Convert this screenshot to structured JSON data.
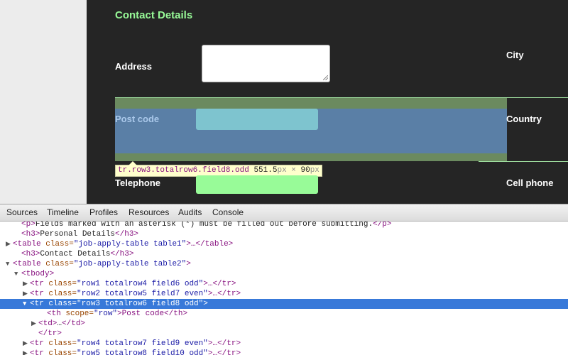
{
  "page": {
    "section_heading": "Contact Details",
    "labels": {
      "address": "Address",
      "city": "City",
      "post_code": "Post code",
      "country": "Country",
      "telephone": "Telephone",
      "cell_phone": "Cell phone"
    },
    "tooltip": {
      "selector": "tr.row3.totalrow6.field8.odd",
      "width": "551.5",
      "times": " × ",
      "height": "90",
      "unit": "px"
    }
  },
  "devtools": {
    "tabs": [
      "Sources",
      "Timeline",
      "Profiles",
      "Resources",
      "Audits",
      "Console"
    ],
    "dom_lines": [
      {
        "indent": 2,
        "tri": "",
        "open": "<p>",
        "text": "Fields marked with an asterisk (*) must be filled out before submitting.",
        "close": "</p>"
      },
      {
        "indent": 2,
        "tri": "",
        "open": "<h3>",
        "text": "Personal Details",
        "close": "</h3>"
      },
      {
        "indent": 1,
        "tri": "▶",
        "open": "<table class=",
        "attrval": "\"job-apply-table table1\"",
        "text": ">…",
        "close": "</table>"
      },
      {
        "indent": 2,
        "tri": "",
        "open": "<h3>",
        "text": "Contact Details",
        "close": "</h3>"
      },
      {
        "indent": 1,
        "tri": "▼",
        "open": "<table class=",
        "attrval": "\"job-apply-table table2\"",
        "text": ">",
        "close": ""
      },
      {
        "indent": 2,
        "tri": "▼",
        "open": "<tbody>",
        "text": "",
        "close": ""
      },
      {
        "indent": 3,
        "tri": "▶",
        "open": "<tr class=",
        "attrval": "\"row1 totalrow4 field6 odd\"",
        "text": ">…",
        "close": "</tr>"
      },
      {
        "indent": 3,
        "tri": "▶",
        "open": "<tr class=",
        "attrval": "\"row2 totalrow5 field7 even\"",
        "text": ">…",
        "close": "</tr>"
      },
      {
        "indent": 3,
        "tri": "▼",
        "open": "<tr class=",
        "attrval": "\"row3 totalrow6 field8 odd\"",
        "text": ">",
        "close": "",
        "selected": true
      },
      {
        "indent": 5,
        "tri": "",
        "open": "<th scope=",
        "attrval": "\"row\"",
        "text": ">Post code",
        "close": "</th>"
      },
      {
        "indent": 4,
        "tri": "▶",
        "open": "<td>",
        "text": "…",
        "close": "</td>"
      },
      {
        "indent": 4,
        "tri": "",
        "open": "</tr>",
        "text": "",
        "close": ""
      },
      {
        "indent": 3,
        "tri": "▶",
        "open": "<tr class=",
        "attrval": "\"row4 totalrow7 field9 even\"",
        "text": ">…",
        "close": "</tr>"
      },
      {
        "indent": 3,
        "tri": "▶",
        "open": "<tr class=",
        "attrval": "\"row5 totalrow8 field10 odd\"",
        "text": ">…",
        "close": "</tr>"
      }
    ]
  }
}
